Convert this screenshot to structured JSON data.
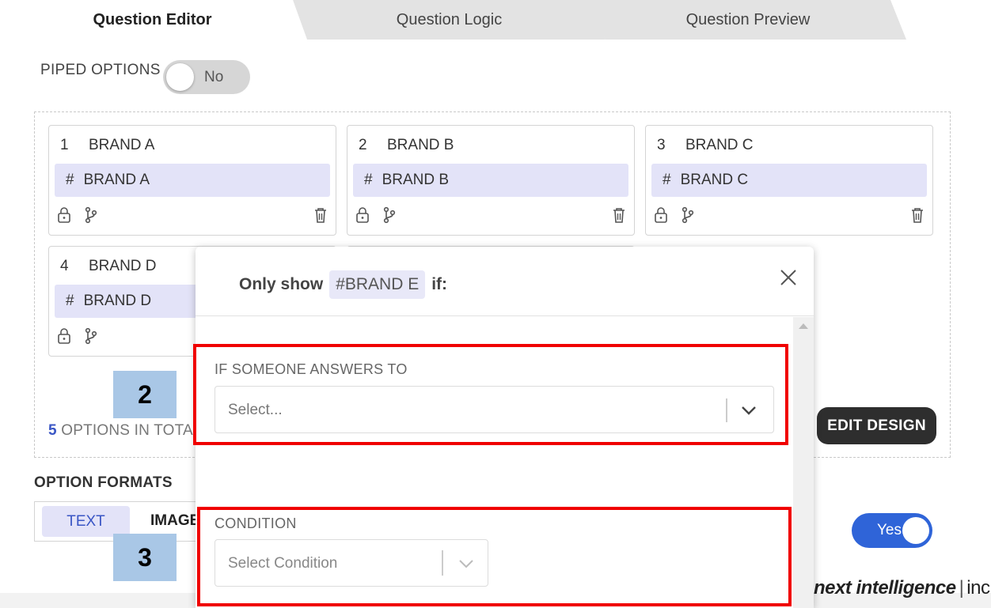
{
  "tabs": [
    {
      "label": "Question Editor",
      "active": true
    },
    {
      "label": "Question Logic",
      "active": false
    },
    {
      "label": "Question Preview",
      "active": false
    }
  ],
  "piped_options": {
    "label": "PIPED OPTIONS",
    "toggle_value": "No"
  },
  "option_cards": [
    {
      "number": "1",
      "name": "BRAND A",
      "code_label": "BRAND A"
    },
    {
      "number": "2",
      "name": "BRAND B",
      "code_label": "BRAND B"
    },
    {
      "number": "3",
      "name": "BRAND C",
      "code_label": "BRAND C"
    },
    {
      "number": "4",
      "name": "BRAND D",
      "code_label": "BRAND D"
    }
  ],
  "hash_symbol": "#",
  "options_total": {
    "count": "5",
    "text": "OPTIONS IN TOTA"
  },
  "edit_design_label": "EDIT DESIGN",
  "option_formats": {
    "label": "OPTION FORMATS",
    "tabs": [
      "TEXT",
      "IMAGE"
    ],
    "selected": "TEXT"
  },
  "yes_toggle": {
    "value": "Yes"
  },
  "logo": {
    "name": "next intelligence",
    "separator": "|",
    "suffix": "inc"
  },
  "modal": {
    "title_prefix": "Only show",
    "title_pill": "#BRAND E",
    "title_suffix": "if:",
    "field1": {
      "label": "IF SOMEONE ANSWERS TO",
      "placeholder": "Select..."
    },
    "field2": {
      "label": "CONDITION",
      "placeholder": "Select Condition"
    }
  },
  "annotations": [
    "2",
    "3"
  ],
  "colors": {
    "accent": "#3a56c5",
    "highlight_red": "#f00000",
    "chip_bg": "#e3e3f8",
    "badge_bg": "#a9c7e6",
    "toggle_on": "#2f64d8"
  }
}
